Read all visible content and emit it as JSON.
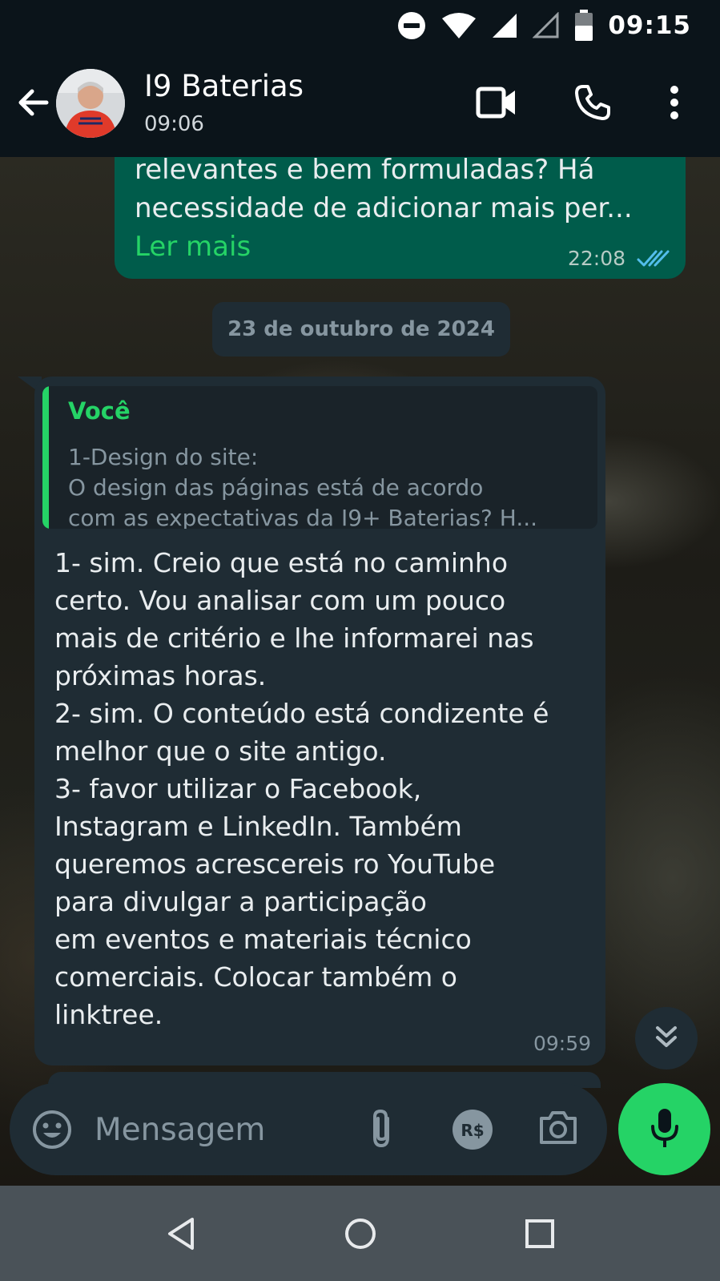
{
  "status_bar": {
    "time": "09:15",
    "icons": [
      "do-not-disturb-icon",
      "wifi-icon",
      "signal-icon",
      "signal-empty-icon",
      "battery-icon"
    ]
  },
  "header": {
    "contact_name": "I9 Baterias",
    "last_seen": "09:06",
    "icons": [
      "back-arrow-icon",
      "video-call-icon",
      "voice-call-icon",
      "more-options-icon"
    ]
  },
  "messages": {
    "outgoing": {
      "lines": [
        "relevantes e bem formuladas? Há",
        "necessidade de adicionar mais per..."
      ],
      "read_more": "Ler mais",
      "time": "22:08",
      "status": "read"
    },
    "date_divider": "23 de outubro de 2024",
    "incoming": {
      "quote_author": "Você",
      "quote_lines": [
        "1-Design do site:",
        "O design das páginas está de acordo",
        "com as expectativas da I9+ Baterias? H..."
      ],
      "lines": [
        "1- sim. Creio que está no caminho",
        "certo. Vou analisar com um pouco",
        "mais de critério e lhe informarei nas",
        "próximas horas.",
        "2- sim. O conteúdo está condizente é",
        "melhor que o site antigo.",
        "3- favor utilizar o Facebook,",
        "Instagram e LinkedIn. Também",
        "queremos acrescereis ro YouTube",
        "para divulgar a participação",
        "em eventos e materiais técnico",
        "comerciais. Colocar também o",
        "linktree."
      ],
      "time": "09:59"
    }
  },
  "compose": {
    "placeholder": "Mensagem",
    "icons": [
      "emoji-icon",
      "attach-icon",
      "payment-icon",
      "camera-icon",
      "microphone-icon"
    ],
    "payment_label": "R$"
  },
  "colors": {
    "accent": "#25d366",
    "outgoing_bubble": "#005c4b",
    "incoming_bubble": "#1f2c34",
    "header_bg": "#0b141a",
    "read_ticks": "#53bdeb"
  }
}
